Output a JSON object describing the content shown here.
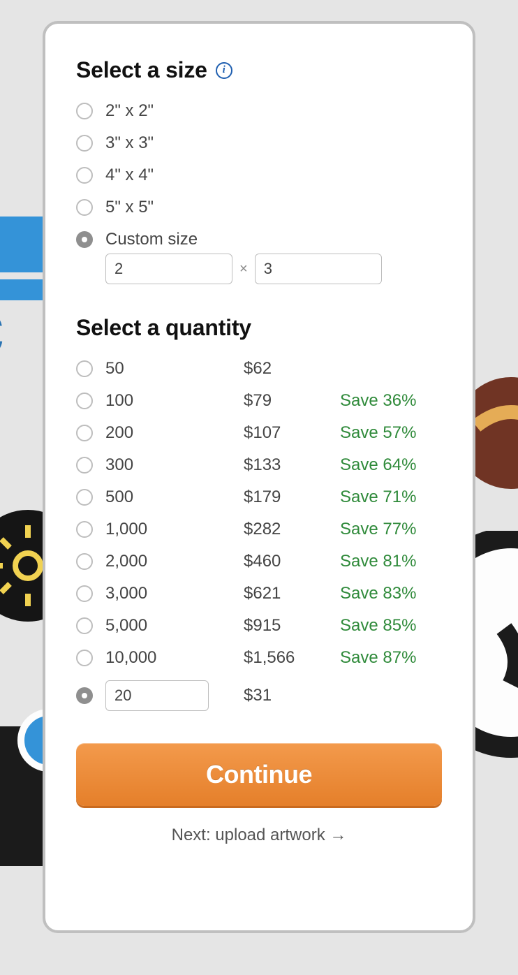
{
  "size_section": {
    "title": "Select a size",
    "options": [
      {
        "label": "2\" x 2\"",
        "selected": false
      },
      {
        "label": "3\" x 3\"",
        "selected": false
      },
      {
        "label": "4\" x 4\"",
        "selected": false
      },
      {
        "label": "5\" x 5\"",
        "selected": false
      },
      {
        "label": "Custom size",
        "selected": true
      }
    ],
    "custom": {
      "width": "2",
      "height": "3",
      "separator": "×"
    }
  },
  "quantity_section": {
    "title": "Select a quantity",
    "options": [
      {
        "qty": "50",
        "price": "$62",
        "save": "",
        "selected": false
      },
      {
        "qty": "100",
        "price": "$79",
        "save": "Save 36%",
        "selected": false
      },
      {
        "qty": "200",
        "price": "$107",
        "save": "Save 57%",
        "selected": false
      },
      {
        "qty": "300",
        "price": "$133",
        "save": "Save 64%",
        "selected": false
      },
      {
        "qty": "500",
        "price": "$179",
        "save": "Save 71%",
        "selected": false
      },
      {
        "qty": "1,000",
        "price": "$282",
        "save": "Save 77%",
        "selected": false
      },
      {
        "qty": "2,000",
        "price": "$460",
        "save": "Save 81%",
        "selected": false
      },
      {
        "qty": "3,000",
        "price": "$621",
        "save": "Save 83%",
        "selected": false
      },
      {
        "qty": "5,000",
        "price": "$915",
        "save": "Save 85%",
        "selected": false
      },
      {
        "qty": "10,000",
        "price": "$1,566",
        "save": "Save 87%",
        "selected": false
      }
    ],
    "custom": {
      "qty": "20",
      "price": "$31",
      "selected": true
    }
  },
  "continue_label": "Continue",
  "next_step_label": "Next: upload artwork →"
}
